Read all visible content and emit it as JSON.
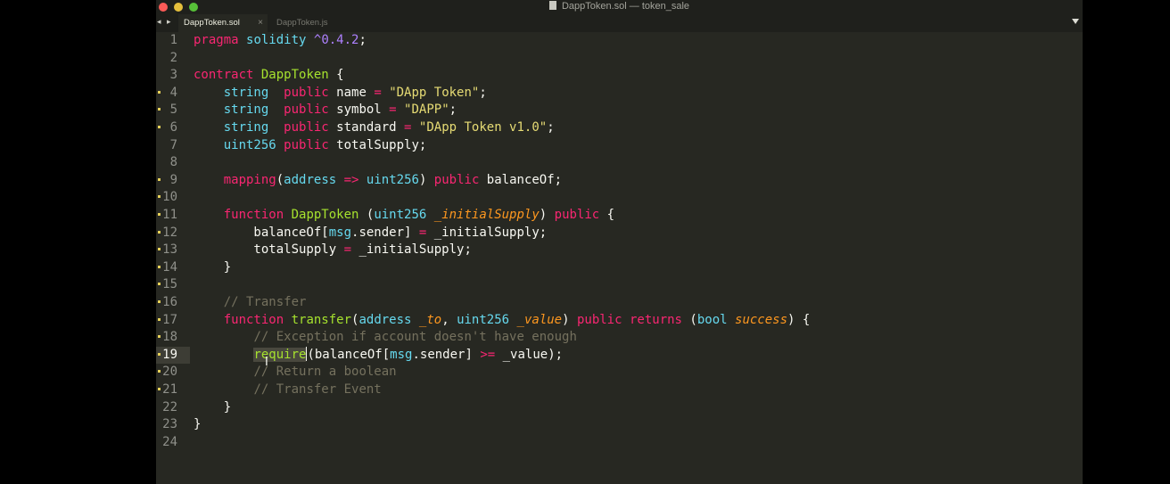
{
  "window": {
    "title": "DappToken.sol — token_sale",
    "tabs": [
      {
        "label": "DappToken.sol",
        "active": true
      },
      {
        "label": "DappToken.js",
        "active": false
      }
    ],
    "tab_close_glyph": "×",
    "tab_nav_glyph": "◂ ▸"
  },
  "editor": {
    "current_line": 19,
    "lines": [
      {
        "n": "1",
        "text": "pragma solidity ^0.4.2;"
      },
      {
        "n": "2",
        "text": ""
      },
      {
        "n": "3",
        "text": "contract DappToken {"
      },
      {
        "n": "4",
        "text": "    string  public name = \"DApp Token\";"
      },
      {
        "n": "5",
        "text": "    string  public symbol = \"DAPP\";"
      },
      {
        "n": "6",
        "text": "    string  public standard = \"DApp Token v1.0\";"
      },
      {
        "n": "7",
        "text": "    uint256 public totalSupply;"
      },
      {
        "n": "8",
        "text": ""
      },
      {
        "n": "9",
        "text": "    mapping(address => uint256) public balanceOf;"
      },
      {
        "n": "10",
        "text": ""
      },
      {
        "n": "11",
        "text": "    function DappToken (uint256 _initialSupply) public {"
      },
      {
        "n": "12",
        "text": "        balanceOf[msg.sender] = _initialSupply;"
      },
      {
        "n": "13",
        "text": "        totalSupply = _initialSupply;"
      },
      {
        "n": "14",
        "text": "    }"
      },
      {
        "n": "15",
        "text": ""
      },
      {
        "n": "16",
        "text": "    // Transfer"
      },
      {
        "n": "17",
        "text": "    function transfer(address _to, uint256 _value) public returns (bool success) {"
      },
      {
        "n": "18",
        "text": "        // Exception if account doesn't have enough"
      },
      {
        "n": "19",
        "text": "        require(balanceOf[msg.sender] >= _value);"
      },
      {
        "n": "20",
        "text": "        // Return a boolean"
      },
      {
        "n": "21",
        "text": "        // Transfer Event"
      },
      {
        "n": "22",
        "text": "    }"
      },
      {
        "n": "23",
        "text": "}"
      },
      {
        "n": "24",
        "text": ""
      }
    ],
    "modified_lines": [
      "4",
      "5",
      "6",
      "9",
      "10",
      "11",
      "12",
      "13",
      "14",
      "15",
      "16",
      "17",
      "18",
      "19",
      "20",
      "21"
    ]
  },
  "colors": {
    "background": "#272822",
    "keyword": "#f92672",
    "type": "#66d9ef",
    "function": "#a6e22e",
    "argument": "#fd971f",
    "string": "#e6db74",
    "number": "#ae81ff",
    "comment": "#75715e"
  }
}
